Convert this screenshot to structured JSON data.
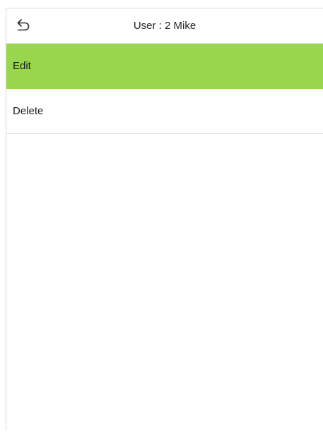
{
  "header": {
    "back_icon": "back-arrow-icon",
    "title": "User : 2 Mike"
  },
  "menu": {
    "items": [
      {
        "label": "Edit",
        "selected": true
      },
      {
        "label": "Delete",
        "selected": false
      }
    ]
  },
  "colors": {
    "accent": "#97D64D",
    "background": "#FFFFFF",
    "divider": "#E3E3E3",
    "text": "#222222"
  }
}
